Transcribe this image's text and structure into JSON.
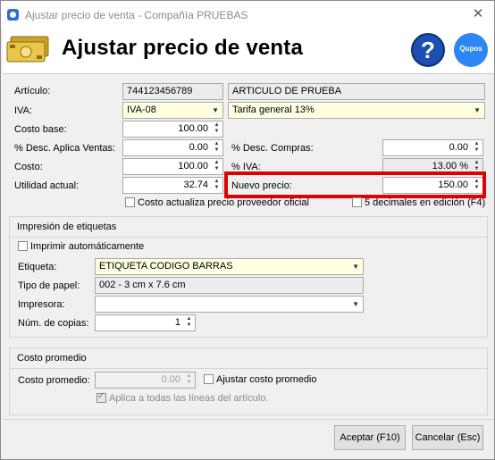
{
  "window": {
    "title": "Ajustar precio de venta - Compañía PRUEBAS",
    "close": "✕"
  },
  "header": {
    "title": "Ajustar precio de venta",
    "help_symbol": "?",
    "logo_text": "Qupos"
  },
  "form": {
    "articulo_label": "Artículo:",
    "articulo_code": "744123456789",
    "articulo_name": "ARTICULO DE PRUEBA",
    "iva_label": "IVA:",
    "iva_value": "IVA-08",
    "tarifa_value": "Tarifa general 13%",
    "costo_base_label": "Costo base:",
    "costo_base_value": "100.00",
    "desc_ventas_label": "% Desc. Aplica Ventas:",
    "desc_ventas_value": "0.00",
    "desc_compras_label": "% Desc. Compras:",
    "desc_compras_value": "0.00",
    "costo_label": "Costo:",
    "costo_value": "100.00",
    "pct_iva_label": "% IVA:",
    "pct_iva_value": "13.00 %",
    "utilidad_label": "Utilidad actual:",
    "utilidad_value": "32.74",
    "nuevo_precio_label": "Nuevo precio:",
    "nuevo_precio_value": "150.00",
    "costo_actualiza_label": "Costo actualiza precio proveedor oficial",
    "cinco_decimales_label": "5 decimales en edición (F4)"
  },
  "etiquetas": {
    "title": "Impresión de etiquetas",
    "imprimir_label": "Imprimir automáticamente",
    "etiqueta_label": "Etiqueta:",
    "etiqueta_value": "ETIQUETA CODIGO BARRAS",
    "papel_label": "Tipo de papel:",
    "papel_value": "002 - 3 cm x 7.6 cm",
    "impresora_label": "Impresora:",
    "impresora_value": "",
    "copias_label": "Núm. de copias:",
    "copias_value": "1"
  },
  "costo_promedio": {
    "title": "Costo promedio",
    "label": "Costo promedio:",
    "value": "0.00",
    "ajustar_label": "Ajustar costo promedio",
    "aplica_label": "Aplica a todas las líneas del artículo."
  },
  "buttons": {
    "accept": "Aceptar (F10)",
    "cancel": "Cancelar (Esc)"
  },
  "icons": {
    "spin_up": "▲",
    "spin_down": "▼",
    "dropdown": "▼"
  }
}
